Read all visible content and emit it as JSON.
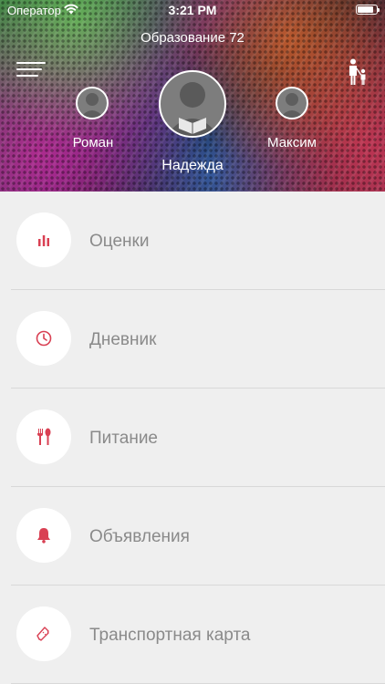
{
  "status_bar": {
    "carrier": "Оператор",
    "time": "3:21 PM",
    "battery_level": 0.85
  },
  "header": {
    "title": "Образование 72",
    "children": [
      {
        "name": "Роман"
      },
      {
        "name": "Надежда"
      },
      {
        "name": "Максим"
      }
    ]
  },
  "menu": {
    "items": [
      {
        "label": "Оценки",
        "icon": "bar-chart-icon"
      },
      {
        "label": "Дневник",
        "icon": "clock-icon"
      },
      {
        "label": "Питание",
        "icon": "fork-spoon-icon"
      },
      {
        "label": "Объявления",
        "icon": "bell-icon"
      },
      {
        "label": "Транспортная карта",
        "icon": "ticket-icon"
      }
    ]
  },
  "colors": {
    "accent": "#d94053",
    "label": "#8a8a8a",
    "list_background": "#efefef"
  }
}
